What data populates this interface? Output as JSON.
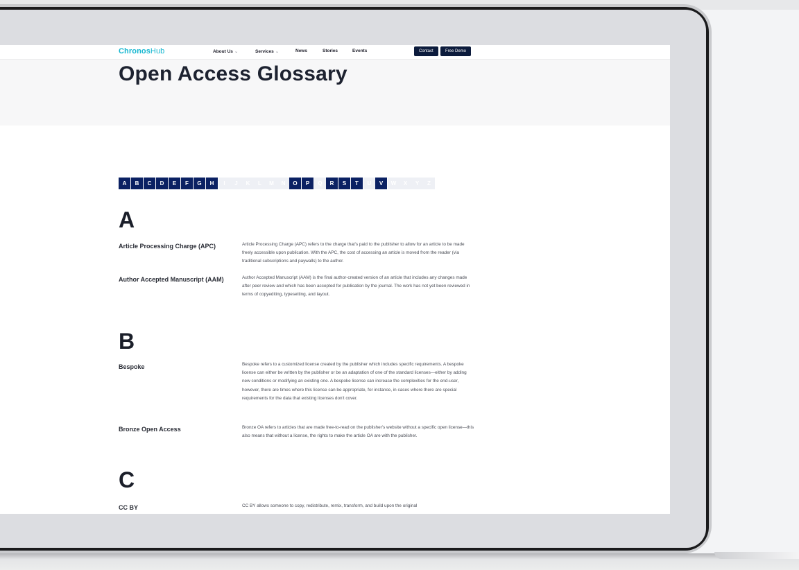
{
  "nav": {
    "logo_part1": "Chronos",
    "logo_part2": "Hub",
    "items": [
      {
        "label": "About Us",
        "chevron": "⌄"
      },
      {
        "label": "Services",
        "chevron": "⌄"
      },
      {
        "label": "News"
      },
      {
        "label": "Stories"
      },
      {
        "label": "Events"
      }
    ],
    "contact_label": "Contact",
    "demo_label": "Free Demo"
  },
  "page_title": "Open Access Glossary",
  "alphabet": [
    {
      "letter": "A",
      "active": true
    },
    {
      "letter": "B",
      "active": true
    },
    {
      "letter": "C",
      "active": true
    },
    {
      "letter": "D",
      "active": true
    },
    {
      "letter": "E",
      "active": true
    },
    {
      "letter": "F",
      "active": true
    },
    {
      "letter": "G",
      "active": true
    },
    {
      "letter": "H",
      "active": true
    },
    {
      "letter": "I",
      "active": false
    },
    {
      "letter": "J",
      "active": false
    },
    {
      "letter": "K",
      "active": false
    },
    {
      "letter": "L",
      "active": false
    },
    {
      "letter": "M",
      "active": false
    },
    {
      "letter": "N",
      "active": false
    },
    {
      "letter": "O",
      "active": true
    },
    {
      "letter": "P",
      "active": true
    },
    {
      "letter": "Q",
      "active": false
    },
    {
      "letter": "R",
      "active": true
    },
    {
      "letter": "S",
      "active": true
    },
    {
      "letter": "T",
      "active": true
    },
    {
      "letter": "U",
      "active": false
    },
    {
      "letter": "V",
      "active": true
    },
    {
      "letter": "W",
      "active": false
    },
    {
      "letter": "X",
      "active": false
    },
    {
      "letter": "Y",
      "active": false
    },
    {
      "letter": "Z",
      "active": false
    }
  ],
  "sections": {
    "a": {
      "letter": "A",
      "terms": [
        {
          "term": "Article Processing Charge (APC)",
          "definition": "Article Processing Charge (APC) refers to the charge that's paid to the publisher to allow for an article to be made freely accessible upon publication. With the APC, the cost of accessing an article is moved from the reader (via traditional subscriptions and paywalls) to the author."
        },
        {
          "term": "Author Accepted Manuscript (AAM)",
          "definition": "Author Accepted Manuscript (AAM) is the final author-created version of an article that includes any changes made after peer review and which has been accepted for publication by the journal. The work has not yet been reviewed in terms of copyediting, typesetting, and layout."
        }
      ]
    },
    "b": {
      "letter": "B",
      "terms": [
        {
          "term": "Bespoke",
          "definition": "Bespoke refers to a customized license created by the publisher which includes specific requirements. A bespoke license can either be written by the publisher or be an adaptation of one of the standard licenses—either by adding new conditions or modifying an existing one. A bespoke license can increase the complexities for the end-user, however, there are times where this license can be appropriate, for instance, in cases where there are special requirements for the data that existing licenses don't cover."
        },
        {
          "term": "Bronze Open Access",
          "definition": "Bronze OA refers to articles that are made free-to-read on the publisher's website without a specific open license—this also means that without a license, the rights to make the article OA are with the publisher."
        }
      ]
    },
    "c": {
      "letter": "C",
      "terms": [
        {
          "term": "CC BY",
          "definition": "CC BY allows someone to copy, redistribute, remix, transform, and build upon the original"
        }
      ]
    }
  }
}
